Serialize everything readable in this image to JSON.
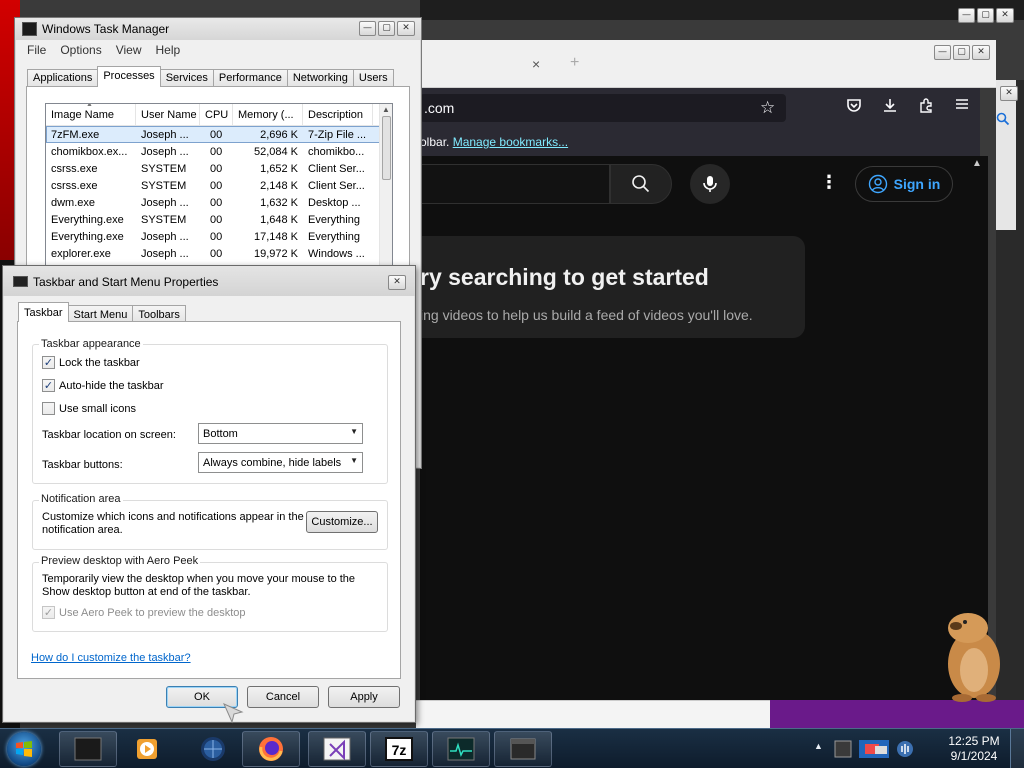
{
  "browser": {
    "url_fragment": ".com",
    "bookmarks_prefix": "olbar.",
    "bookmarks_link": "Manage bookmarks...",
    "tab_close": "×",
    "tab_new": "+",
    "signin_label": "Sign in",
    "empty_heading": "ry searching to get started",
    "empty_subtext": "ing videos to help us build a feed of videos you'll love."
  },
  "task_manager": {
    "title": "Windows Task Manager",
    "menu": [
      "File",
      "Options",
      "View",
      "Help"
    ],
    "tabs": [
      {
        "label": "Applications",
        "active": false
      },
      {
        "label": "Processes",
        "active": true
      },
      {
        "label": "Services",
        "active": false
      },
      {
        "label": "Performance",
        "active": false
      },
      {
        "label": "Networking",
        "active": false
      },
      {
        "label": "Users",
        "active": false
      }
    ],
    "columns": [
      "Image Name",
      "User Name",
      "CPU",
      "Memory (...",
      "Description"
    ],
    "rows": [
      {
        "image": "7zFM.exe",
        "user": "Joseph ...",
        "cpu": "00",
        "mem": "2,696 K",
        "desc": "7-Zip File ...",
        "selected": true
      },
      {
        "image": "chomikbox.ex...",
        "user": "Joseph ...",
        "cpu": "00",
        "mem": "52,084 K",
        "desc": "chomikbo...",
        "selected": false
      },
      {
        "image": "csrss.exe",
        "user": "SYSTEM",
        "cpu": "00",
        "mem": "1,652 K",
        "desc": "Client Ser...",
        "selected": false
      },
      {
        "image": "csrss.exe",
        "user": "SYSTEM",
        "cpu": "00",
        "mem": "2,148 K",
        "desc": "Client Ser...",
        "selected": false
      },
      {
        "image": "dwm.exe",
        "user": "Joseph ...",
        "cpu": "00",
        "mem": "1,632 K",
        "desc": "Desktop ...",
        "selected": false
      },
      {
        "image": "Everything.exe",
        "user": "SYSTEM",
        "cpu": "00",
        "mem": "1,648 K",
        "desc": "Everything",
        "selected": false
      },
      {
        "image": "Everything.exe",
        "user": "Joseph ...",
        "cpu": "00",
        "mem": "17,148 K",
        "desc": "Everything",
        "selected": false
      },
      {
        "image": "explorer.exe",
        "user": "Joseph ...",
        "cpu": "00",
        "mem": "19,972 K",
        "desc": "Windows ...",
        "selected": false
      }
    ]
  },
  "taskbar_props": {
    "title": "Taskbar and Start Menu Properties",
    "tabs": [
      {
        "label": "Taskbar",
        "active": true
      },
      {
        "label": "Start Menu",
        "active": false
      },
      {
        "label": "Toolbars",
        "active": false
      }
    ],
    "appearance": {
      "title": "Taskbar appearance",
      "lock_label": "Lock the taskbar",
      "lock_checked": true,
      "autohide_label": "Auto-hide the taskbar",
      "autohide_checked": true,
      "small_icons_label": "Use small icons",
      "small_icons_checked": false,
      "location_label": "Taskbar location on screen:",
      "location_value": "Bottom",
      "buttons_label": "Taskbar buttons:",
      "buttons_value": "Always combine, hide labels"
    },
    "notification": {
      "title": "Notification area",
      "text": "Customize which icons and notifications appear in the notification area.",
      "customize_label": "Customize..."
    },
    "peek": {
      "title": "Preview desktop with Aero Peek",
      "text": "Temporarily view the desktop when you move your mouse to the Show desktop button at end of the taskbar.",
      "checkbox_label": "Use Aero Peek to preview the desktop",
      "checkbox_checked": true,
      "checkbox_disabled": true
    },
    "help_link": "How do I customize the taskbar?",
    "buttons": {
      "ok": "OK",
      "cancel": "Cancel",
      "apply": "Apply"
    }
  },
  "taskbar": {
    "apps": [
      "media-player-icon",
      "vpn-globe-icon",
      "firefox-icon",
      "visual-studio-icon",
      "7zip-icon",
      "resource-monitor-icon",
      "window-icon"
    ],
    "clock_time": "12:25 PM",
    "clock_date": "9/1/2024"
  },
  "colors": {
    "accent_link": "#0066cc",
    "youtube_blue": "#3ea6ff",
    "taskbar_bg": "#0e1c2c",
    "selection": "#dcecfc"
  }
}
